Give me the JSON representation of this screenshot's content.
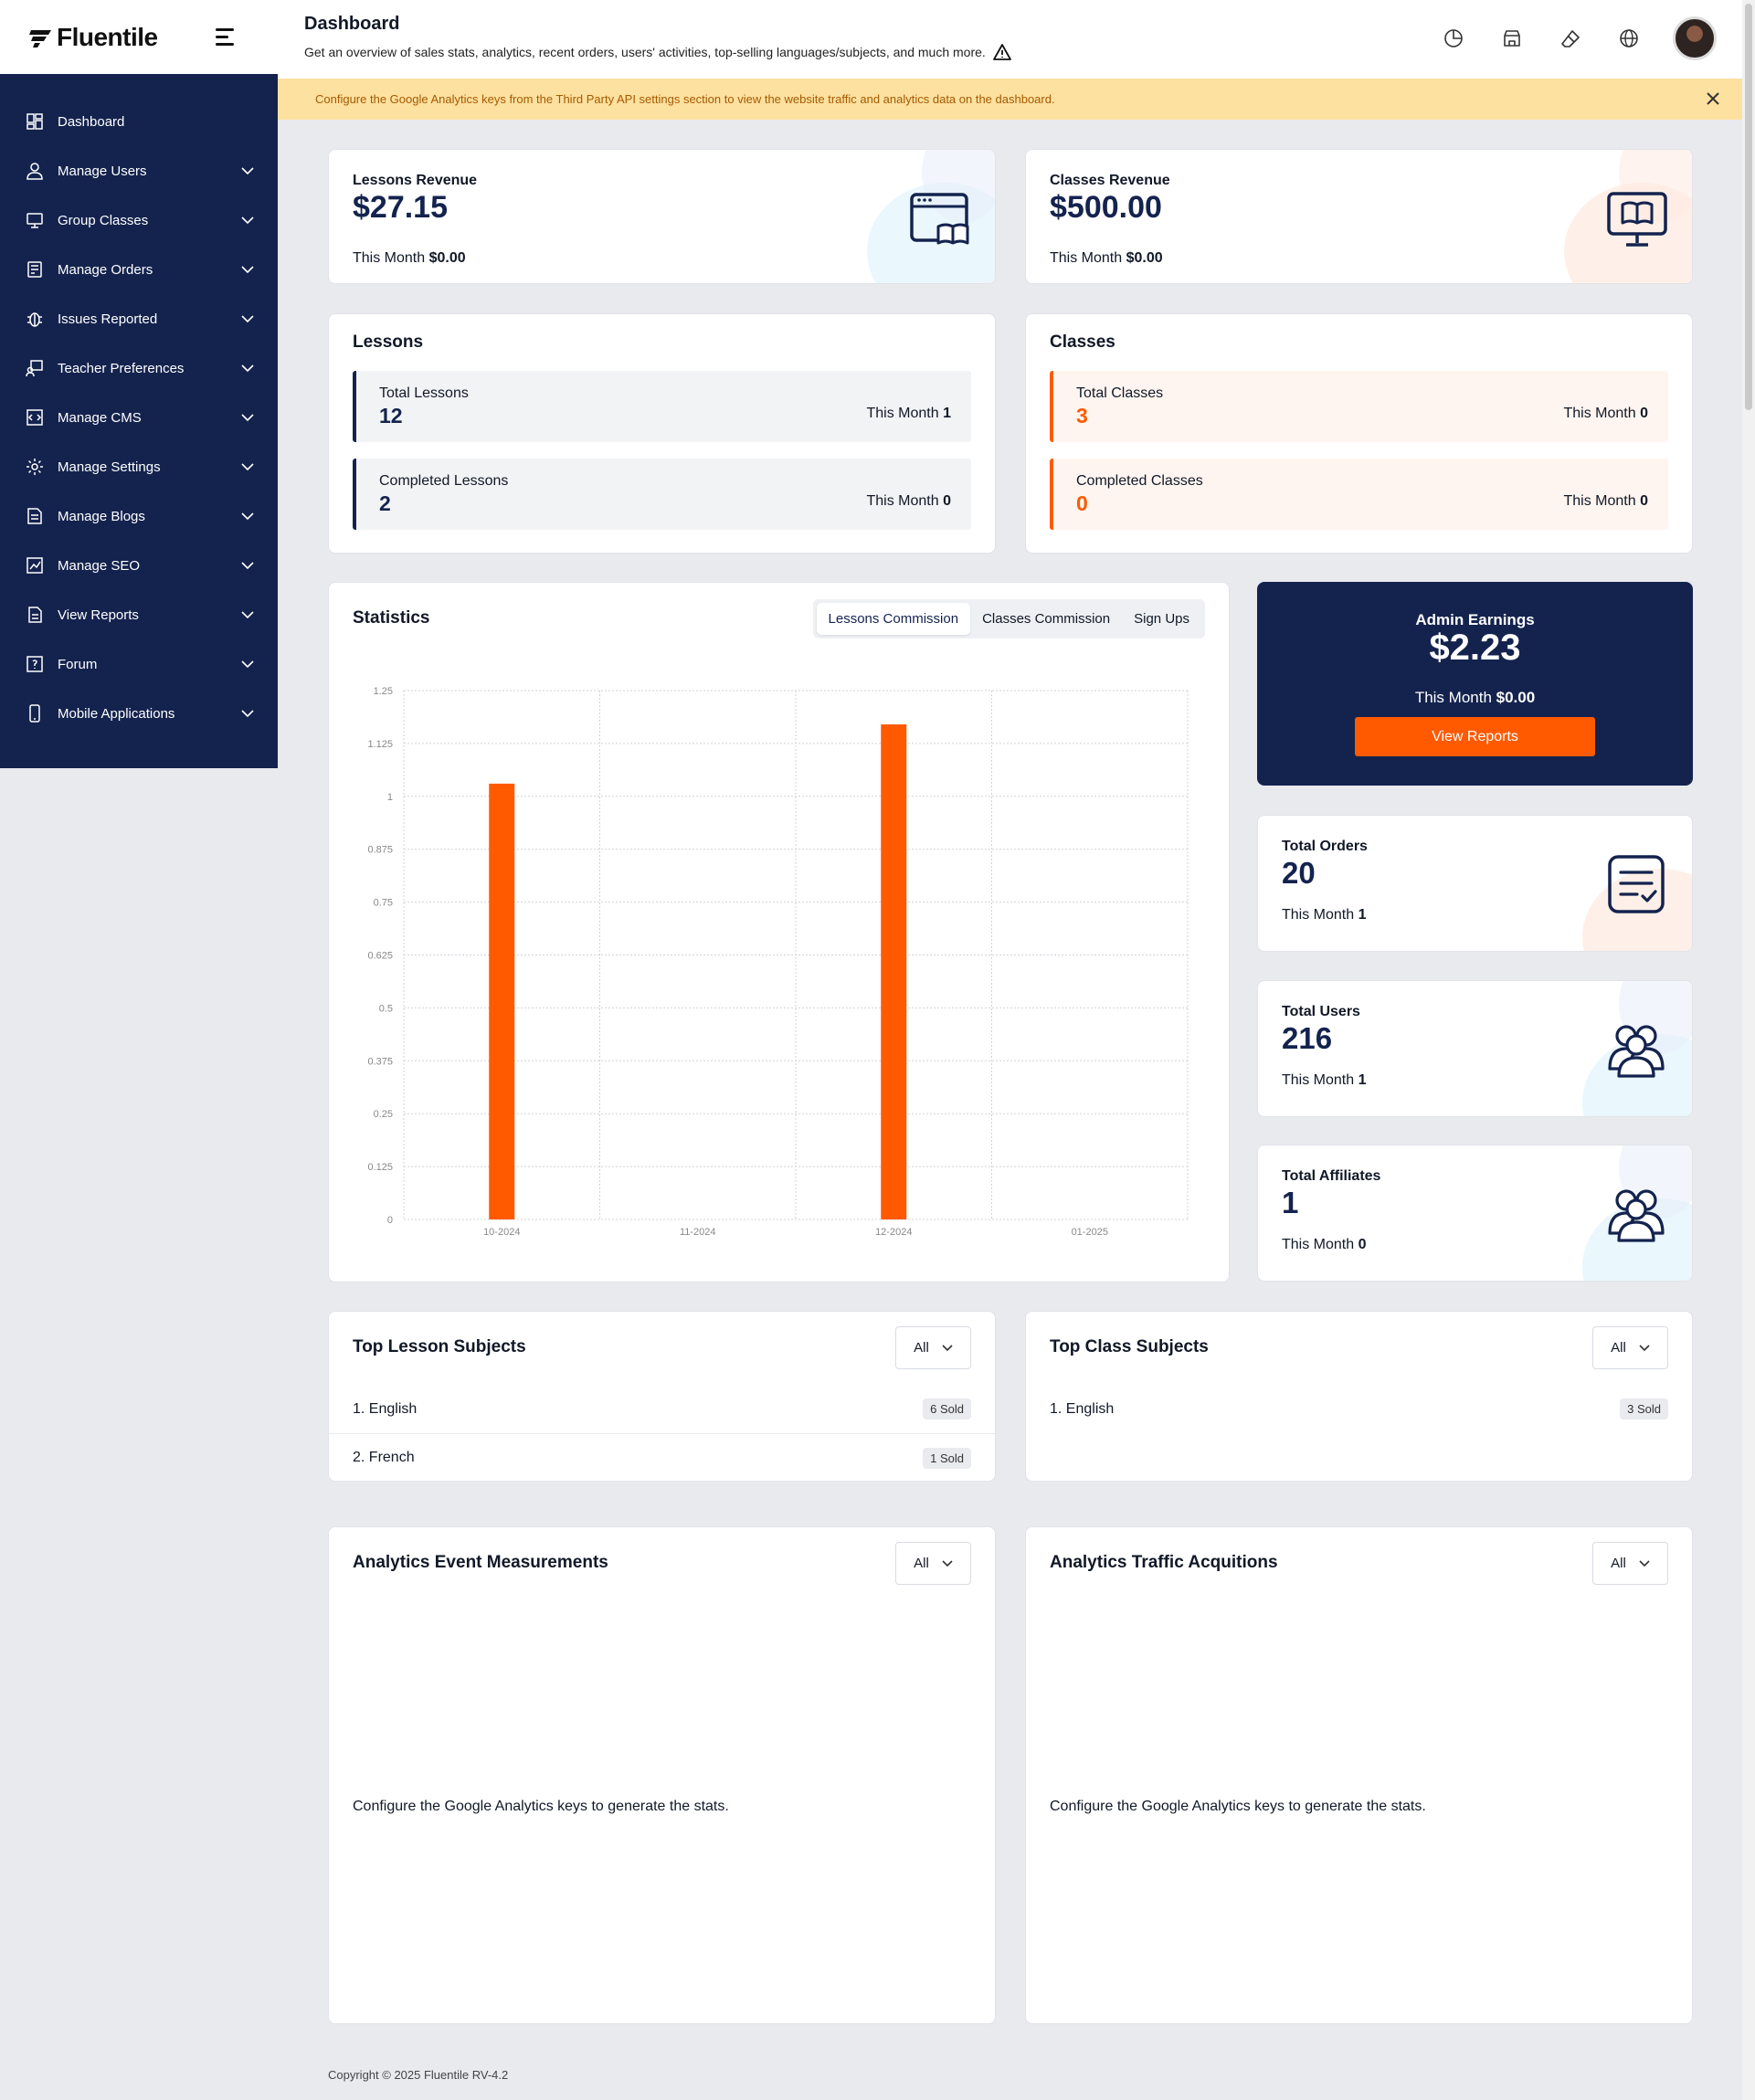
{
  "brand": {
    "name": "Fluentile"
  },
  "sidebar": {
    "items": [
      {
        "label": "Dashboard",
        "icon": "dashboard-icon",
        "chevron": false
      },
      {
        "label": "Manage Users",
        "icon": "user-icon",
        "chevron": true
      },
      {
        "label": "Group Classes",
        "icon": "presentation-icon",
        "chevron": true
      },
      {
        "label": "Manage Orders",
        "icon": "order-icon",
        "chevron": true
      },
      {
        "label": "Issues Reported",
        "icon": "bug-icon",
        "chevron": true
      },
      {
        "label": "Teacher Preferences",
        "icon": "teacher-icon",
        "chevron": true
      },
      {
        "label": "Manage CMS",
        "icon": "cms-icon",
        "chevron": true
      },
      {
        "label": "Manage Settings",
        "icon": "gear-icon",
        "chevron": true
      },
      {
        "label": "Manage Blogs",
        "icon": "blog-icon",
        "chevron": true
      },
      {
        "label": "Manage SEO",
        "icon": "seo-icon",
        "chevron": true
      },
      {
        "label": "View Reports",
        "icon": "report-icon",
        "chevron": true
      },
      {
        "label": "Forum",
        "icon": "forum-icon",
        "chevron": true
      },
      {
        "label": "Mobile Applications",
        "icon": "mobile-icon",
        "chevron": true
      }
    ]
  },
  "header": {
    "title": "Dashboard",
    "subtitle": "Get an overview of sales stats, analytics, recent orders, users' activities, top-selling languages/subjects, and much more."
  },
  "banner": {
    "text": "Configure the Google Analytics keys from the Third Party API settings section to view the website traffic and analytics data on the dashboard."
  },
  "revenue": {
    "lessons": {
      "label": "Lessons Revenue",
      "value": "$27.15",
      "month_label": "This Month",
      "month_value": "$0.00"
    },
    "classes": {
      "label": "Classes Revenue",
      "value": "$500.00",
      "month_label": "This Month",
      "month_value": "$0.00"
    }
  },
  "lessons": {
    "title": "Lessons",
    "total": {
      "label": "Total Lessons",
      "value": "12",
      "month_label": "This Month",
      "month_value": "1"
    },
    "completed": {
      "label": "Completed Lessons",
      "value": "2",
      "month_label": "This Month",
      "month_value": "0"
    }
  },
  "classes": {
    "title": "Classes",
    "total": {
      "label": "Total Classes",
      "value": "3",
      "month_label": "This Month",
      "month_value": "0"
    },
    "completed": {
      "label": "Completed Classes",
      "value": "0",
      "month_label": "This Month",
      "month_value": "0"
    }
  },
  "statistics": {
    "title": "Statistics",
    "tabs": [
      "Lessons Commission",
      "Classes Commission",
      "Sign Ups"
    ],
    "active_tab": 0
  },
  "chart_data": {
    "type": "bar",
    "title": "",
    "xlabel": "",
    "ylabel": "",
    "categories": [
      "10-2024",
      "11-2024",
      "12-2024",
      "01-2025"
    ],
    "values": [
      1.03,
      0,
      1.17,
      0
    ],
    "ylim": [
      0,
      1.25
    ],
    "yticks": [
      "0",
      "0.125",
      "0.25",
      "0.375",
      "0.5",
      "0.625",
      "0.75",
      "0.875",
      "1",
      "1.125",
      "1.25"
    ],
    "color": "#ff5a00",
    "grid": true
  },
  "earnings": {
    "label": "Admin Earnings",
    "value": "$2.23",
    "month_label": "This Month",
    "month_value": "$0.00",
    "button": "View Reports"
  },
  "orders": {
    "label": "Total Orders",
    "value": "20",
    "month_label": "This Month",
    "month_value": "1"
  },
  "users": {
    "label": "Total Users",
    "value": "216",
    "month_label": "This Month",
    "month_value": "1"
  },
  "affiliates": {
    "label": "Total Affiliates",
    "value": "1",
    "month_label": "This Month",
    "month_value": "0"
  },
  "top_lessons": {
    "title": "Top Lesson Subjects",
    "filter": "All",
    "items": [
      {
        "name": "1. English",
        "sold": "6 Sold"
      },
      {
        "name": "2. French",
        "sold": "1 Sold"
      }
    ]
  },
  "top_classes": {
    "title": "Top Class Subjects",
    "filter": "All",
    "items": [
      {
        "name": "1. English",
        "sold": "3 Sold"
      }
    ]
  },
  "analytics_events": {
    "title": "Analytics Event Measurements",
    "filter": "All",
    "message": "Configure the Google Analytics keys to generate the stats."
  },
  "analytics_traffic": {
    "title": "Analytics Traffic Acquitions",
    "filter": "All",
    "message": "Configure the Google Analytics keys to generate the stats."
  },
  "footer": {
    "text": "Copyright © 2025 Fluentile RV-4.2"
  },
  "colors": {
    "navy": "#14234e",
    "accent": "#ff5a00",
    "banner": "#fde1a0"
  }
}
